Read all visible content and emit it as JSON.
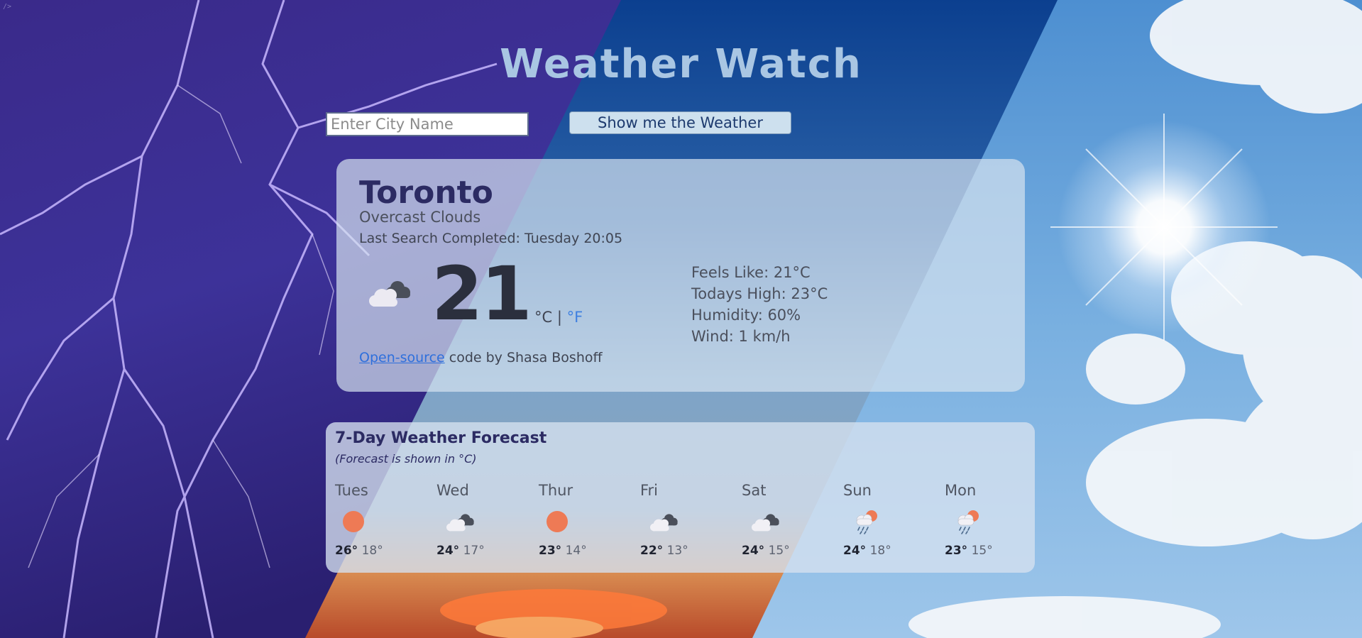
{
  "app_title": "Weather Watch",
  "search": {
    "placeholder": "Enter City Name",
    "button_label": "Show me the Weather"
  },
  "current": {
    "city": "Toronto",
    "description": "Overcast Clouds",
    "last_search": "Last Search Completed: Tuesday 20:05",
    "icon": "overcast-clouds-icon",
    "temperature": "21",
    "unit_c": "°C",
    "unit_sep": "|",
    "unit_f": "°F",
    "feels_like": "Feels Like: 21°C",
    "todays_high": "Todays High: 23°C",
    "humidity": "Humidity: 60%",
    "wind": "Wind: 1 km/h",
    "credit_link": "Open-source",
    "credit_text": " code by Shasa Boshoff"
  },
  "forecast": {
    "title": "7-Day Weather Forecast",
    "note": "(Forecast is shown in °C)",
    "days": [
      {
        "day": "Tues",
        "icon": "sun-icon",
        "max": "26°",
        "min": "18°"
      },
      {
        "day": "Wed",
        "icon": "overcast-clouds-icon",
        "max": "24°",
        "min": "17°"
      },
      {
        "day": "Thur",
        "icon": "sun-icon",
        "max": "23°",
        "min": "14°"
      },
      {
        "day": "Fri",
        "icon": "overcast-clouds-icon",
        "max": "22°",
        "min": "13°"
      },
      {
        "day": "Sat",
        "icon": "overcast-clouds-icon",
        "max": "24°",
        "min": "15°"
      },
      {
        "day": "Sun",
        "icon": "rain-sun-icon",
        "max": "24°",
        "min": "18°"
      },
      {
        "day": "Mon",
        "icon": "rain-sun-icon",
        "max": "23°",
        "min": "15°"
      }
    ]
  },
  "colors": {
    "title": "#a9c6e3",
    "accent_link": "#3f80e0",
    "sun": "#ee7a55",
    "heading": "#2c2b63"
  }
}
